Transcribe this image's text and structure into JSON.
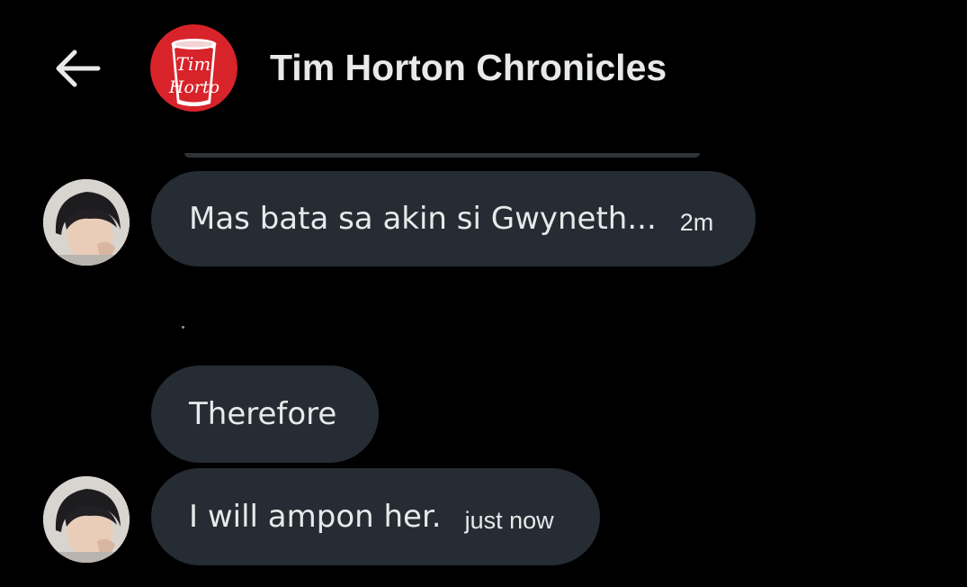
{
  "header": {
    "back_icon": "arrow-left-icon",
    "group_avatar_icon": "tim-hortons-cup-logo",
    "logo_text_line1": "Tim",
    "logo_text_line2": "Horto",
    "title": "Tim Horton Chronicles"
  },
  "messages": [
    {
      "text": "Mas bata sa akin si Gwyneth...",
      "time": "2m",
      "has_avatar": true
    },
    {
      "text": "Therefore",
      "time": "",
      "has_avatar": false
    },
    {
      "text": "I will ampon her.",
      "time": "just now",
      "has_avatar": true
    }
  ],
  "colors": {
    "background": "#000000",
    "bubble": "#252c33",
    "text": "#e7e9ea",
    "logo_red": "#d8232a"
  }
}
